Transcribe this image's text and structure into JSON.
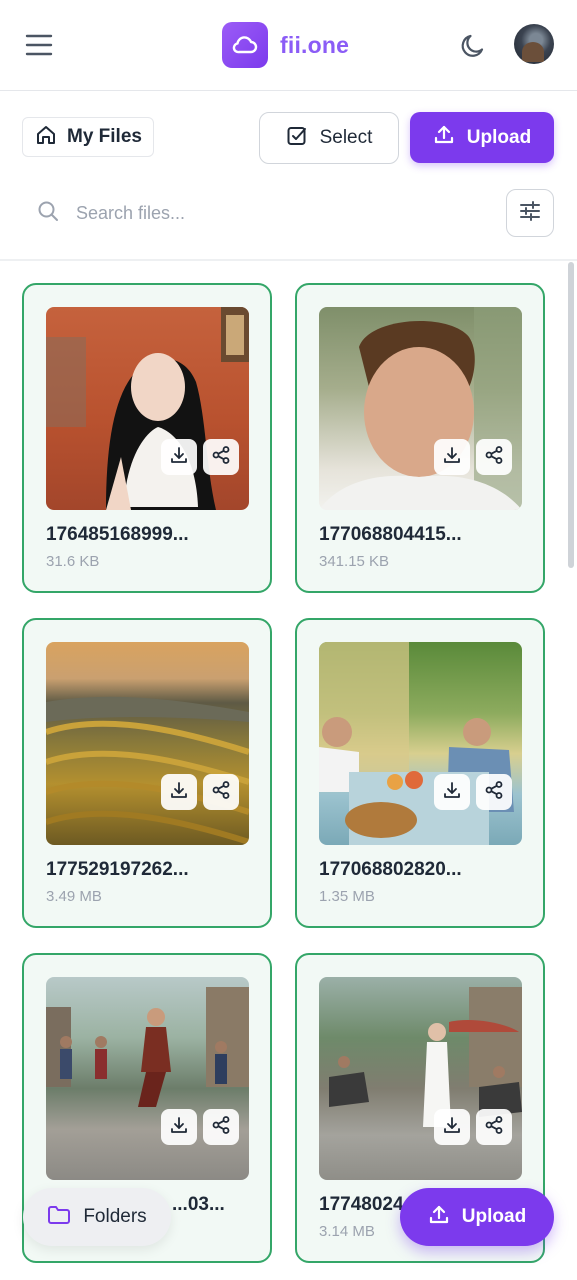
{
  "header": {
    "brand": "fii.one",
    "brand_color": "#8b5cf6",
    "icons": [
      "menu-icon",
      "cloud-icon",
      "moon-icon",
      "avatar"
    ]
  },
  "toolbar": {
    "my_files_label": "My Files",
    "select_label": "Select",
    "upload_label": "Upload",
    "search_placeholder": "Search files...",
    "accent": "#7c3aed"
  },
  "files": [
    {
      "name": "176485168999...",
      "size": "31.6 KB"
    },
    {
      "name": "177068804415...",
      "size": "341.15 KB"
    },
    {
      "name": "177529197262...",
      "size": "3.49 MB"
    },
    {
      "name": "177068802820...",
      "size": "1.35 MB"
    },
    {
      "name": "...03...",
      "size": ""
    },
    {
      "name": "17748024",
      "size": "3.14 MB"
    }
  ],
  "card_border_color": "#34a668",
  "floating": {
    "folders_label": "Folders",
    "upload_label": "Upload"
  }
}
